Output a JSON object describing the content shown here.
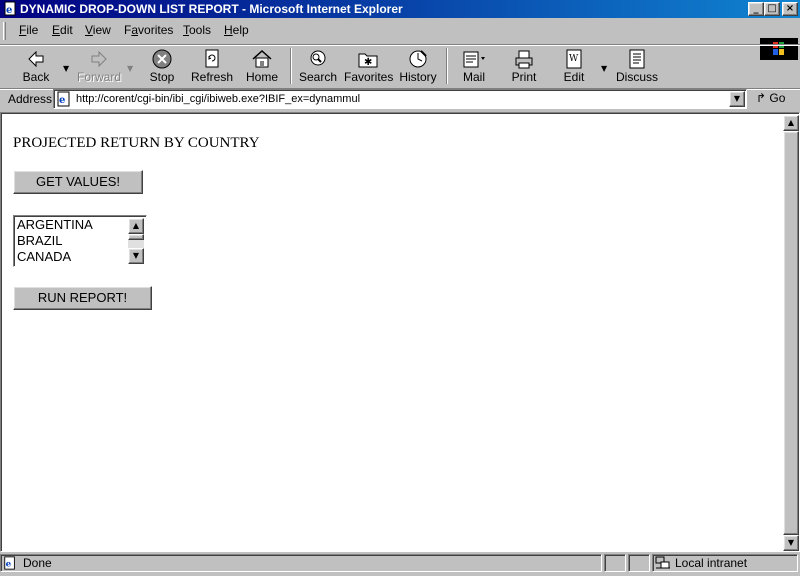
{
  "window": {
    "title": "DYNAMIC DROP-DOWN LIST REPORT - Microsoft Internet Explorer",
    "controls": {
      "minimize": "_",
      "maximize": "□",
      "close": "×"
    }
  },
  "menu": {
    "items": [
      {
        "label": "File",
        "accel": "F"
      },
      {
        "label": "Edit",
        "accel": "E"
      },
      {
        "label": "View",
        "accel": "V"
      },
      {
        "label": "Favorites",
        "accel": "a"
      },
      {
        "label": "Tools",
        "accel": "T"
      },
      {
        "label": "Help",
        "accel": "H"
      }
    ]
  },
  "toolbar": {
    "back": "Back",
    "forward": "Forward",
    "stop": "Stop",
    "refresh": "Refresh",
    "home": "Home",
    "search": "Search",
    "favorites": "Favorites",
    "history": "History",
    "mail": "Mail",
    "print": "Print",
    "edit": "Edit",
    "discuss": "Discuss",
    "icons": [
      "back-arrow-icon",
      "forward-arrow-icon",
      "stop-icon",
      "refresh-icon",
      "home-icon",
      "search-icon",
      "favorites-icon",
      "history-icon",
      "mail-icon",
      "print-icon",
      "edit-icon",
      "discuss-icon"
    ]
  },
  "address": {
    "label": "Address",
    "url": "http://corent/cgi-bin/ibi_cgi/ibiweb.exe?IBIF_ex=dynammul",
    "go": "Go"
  },
  "page": {
    "title": "PROJECTED RETURN BY COUNTRY",
    "get_values_button": "GET VALUES!",
    "countries": [
      "ARGENTINA",
      "BRAZIL",
      "CANADA"
    ],
    "run_report_button": "RUN REPORT!"
  },
  "status": {
    "text": "Done",
    "zone": "Local intranet"
  },
  "colors": {
    "titlebar_start": "#000080",
    "titlebar_end": "#1084d0",
    "chrome": "#c0c0c0"
  }
}
